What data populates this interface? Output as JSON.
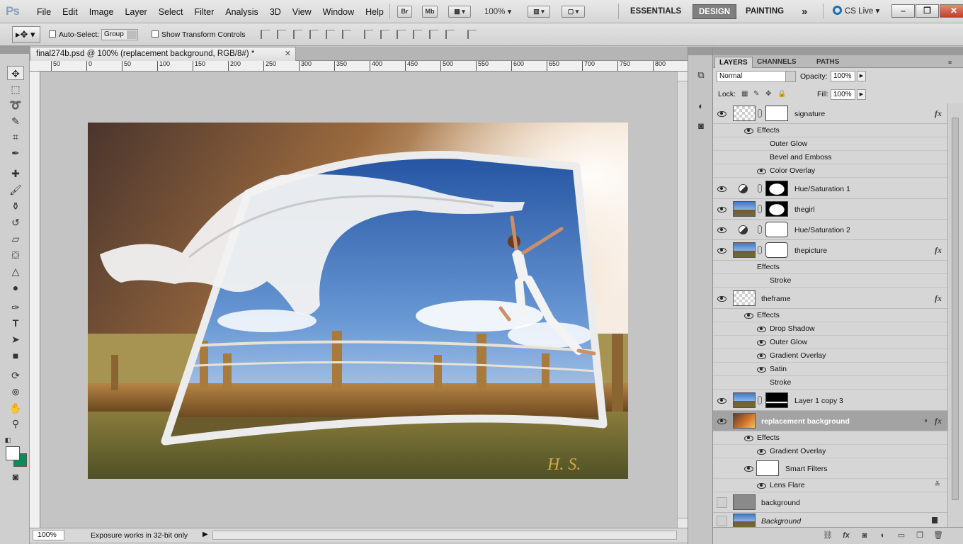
{
  "app": {
    "logo": "Ps",
    "menus": [
      "File",
      "Edit",
      "Image",
      "Layer",
      "Select",
      "Filter",
      "Analysis",
      "3D",
      "View",
      "Window",
      "Help"
    ],
    "bridge_label": "Br",
    "minibridge_label": "Mb",
    "zoom_level": "100%",
    "workspaces": [
      "ESSENTIALS",
      "DESIGN",
      "PAINTING"
    ],
    "active_workspace": "DESIGN",
    "more_workspaces": "»",
    "cs_live": "CS Live"
  },
  "options_bar": {
    "auto_select_label": "Auto-Select:",
    "auto_select_value": "Group",
    "show_transform_label": "Show Transform Controls"
  },
  "document": {
    "tab_title": "final274b.psd @ 100% (replacement background, RGB/8#) *",
    "ruler_labels": [
      "50",
      "0",
      "50",
      "100",
      "150",
      "200",
      "250",
      "300",
      "350",
      "400",
      "450",
      "500",
      "550",
      "600",
      "650",
      "700",
      "750",
      "800"
    ],
    "signature_text": "H. S.",
    "status_zoom": "100%",
    "status_info": "Exposure works in 32-bit only"
  },
  "layers_panel": {
    "tabs": [
      "LAYERS",
      "CHANNELS",
      "PATHS"
    ],
    "blend_mode": "Normal",
    "opacity_label": "Opacity:",
    "opacity_value": "100%",
    "lock_label": "Lock:",
    "fill_label": "Fill:",
    "fill_value": "100%",
    "layers": [
      {
        "name": "signature",
        "effects_label": "Effects",
        "effects": [
          "Outer Glow",
          "Bevel and Emboss",
          "Color Overlay"
        ]
      },
      {
        "name": "Hue/Saturation 1"
      },
      {
        "name": "thegirl"
      },
      {
        "name": "Hue/Saturation 2"
      },
      {
        "name": "thepicture",
        "effects_label": "Effects",
        "effects": [
          "Stroke"
        ]
      },
      {
        "name": "theframe",
        "effects_label": "Effects",
        "effects": [
          "Drop Shadow",
          "Outer Glow",
          "Gradient Overlay",
          "Satin",
          "Stroke"
        ]
      },
      {
        "name": "Layer 1 copy 3"
      },
      {
        "name": "replacement background",
        "effects_label": "Effects",
        "effects": [
          "Gradient Overlay"
        ],
        "smart_filters_label": "Smart Filters",
        "smart_filters": [
          "Lens Flare"
        ]
      },
      {
        "name": "background"
      },
      {
        "name": "Background"
      }
    ]
  }
}
